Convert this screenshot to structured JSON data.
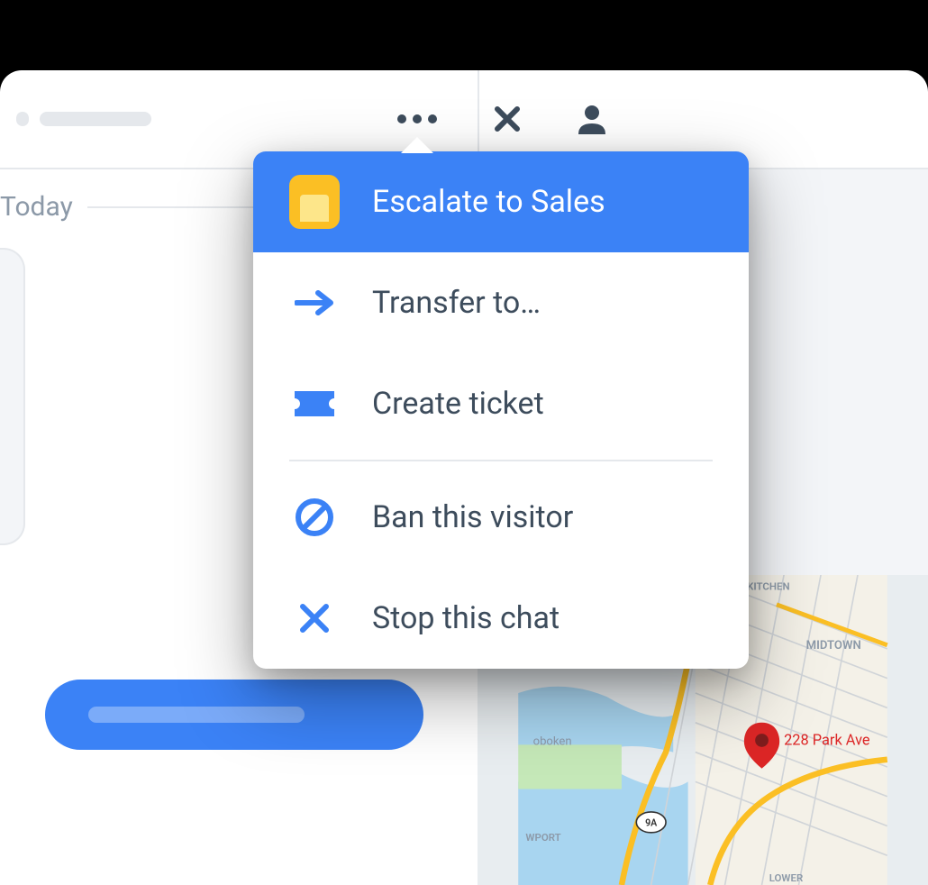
{
  "toolbar": {
    "more_icon": "more-horizontal",
    "close_icon": "close",
    "person_icon": "person"
  },
  "chat": {
    "date_divider": "Today"
  },
  "menu": {
    "items": [
      {
        "label": "Escalate to Sales",
        "icon": "app-yellow",
        "highlighted": true
      },
      {
        "label": "Transfer to…",
        "icon": "arrow-right",
        "highlighted": false
      },
      {
        "label": "Create ticket",
        "icon": "ticket",
        "highlighted": false
      },
      {
        "label": "Ban this visitor",
        "icon": "ban",
        "highlighted": false
      },
      {
        "label": "Stop this chat",
        "icon": "close",
        "highlighted": false
      }
    ]
  },
  "map": {
    "address_label": "228 Park Ave",
    "area_labels": {
      "kitchen": "KITCHEN",
      "midtown": "MIDTOWN",
      "hoboken": "oboken",
      "newport": "WPORT",
      "lower": "LOWER"
    },
    "route_badge": "9A"
  }
}
